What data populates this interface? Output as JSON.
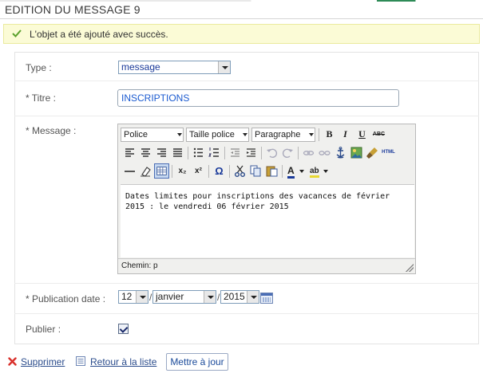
{
  "header": {
    "title": "EDITION DU MESSAGE 9"
  },
  "notice": {
    "message": "L'objet a été ajouté avec succès."
  },
  "form": {
    "type": {
      "label": "Type :",
      "value": "message"
    },
    "title": {
      "label": "* Titre :",
      "value": "INSCRIPTIONS"
    },
    "message": {
      "label": "* Message :",
      "toolbar": {
        "font": "Police",
        "font_size": "Taille police",
        "format": "Paragraphe",
        "bold": "B",
        "italic": "I",
        "underline": "U",
        "strike": "ABC",
        "html": "HTML",
        "omega": "Ω",
        "subscript": "x₂",
        "superscript": "x²",
        "font_color": "A",
        "highlight": "ab"
      },
      "content": "Dates limites pour inscriptions des vacances de février 2015 : le vendredi 06 février 2015",
      "status": "Chemin: p"
    },
    "publication_date": {
      "label": "* Publication date :",
      "day": "12",
      "month": "janvier",
      "year": "2015",
      "separator": "/"
    },
    "publish": {
      "label": "Publier :",
      "checked": true
    }
  },
  "actions": {
    "delete": "Supprimer",
    "back": "Retour à la liste",
    "update": "Mettre à jour"
  },
  "colors": {
    "link": "#2b4c8c",
    "success_bg": "#fbfbd6",
    "check_green": "#5aa02c",
    "delete_red": "#d9302b"
  }
}
